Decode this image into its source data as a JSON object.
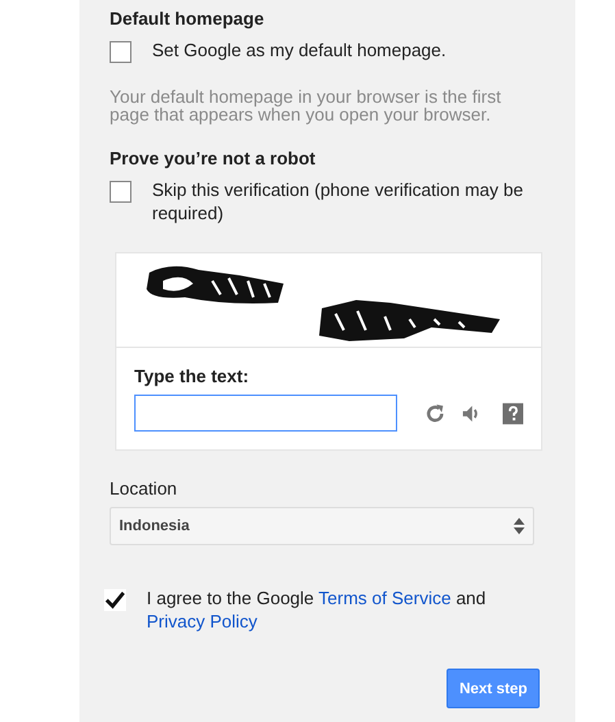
{
  "homepage": {
    "heading": "Default homepage",
    "option": {
      "label": "Set Google as my default homepage.",
      "checked": false
    },
    "hint": "Your default homepage in your browser is the first page that appears when you open your browser."
  },
  "robot": {
    "heading": "Prove you’re not a robot",
    "option": {
      "label": "Skip this verification (phone verification may be required)",
      "checked": false
    }
  },
  "captcha": {
    "label": "Type the text:"
  },
  "location": {
    "label": "Location",
    "value": "Indonesia"
  },
  "agree": {
    "checked": true,
    "before": "I agree to the Google ",
    "link_1": "Terms of Service",
    "middle": " and",
    "link_2": "Privacy Policy"
  },
  "next_button": "Next step"
}
